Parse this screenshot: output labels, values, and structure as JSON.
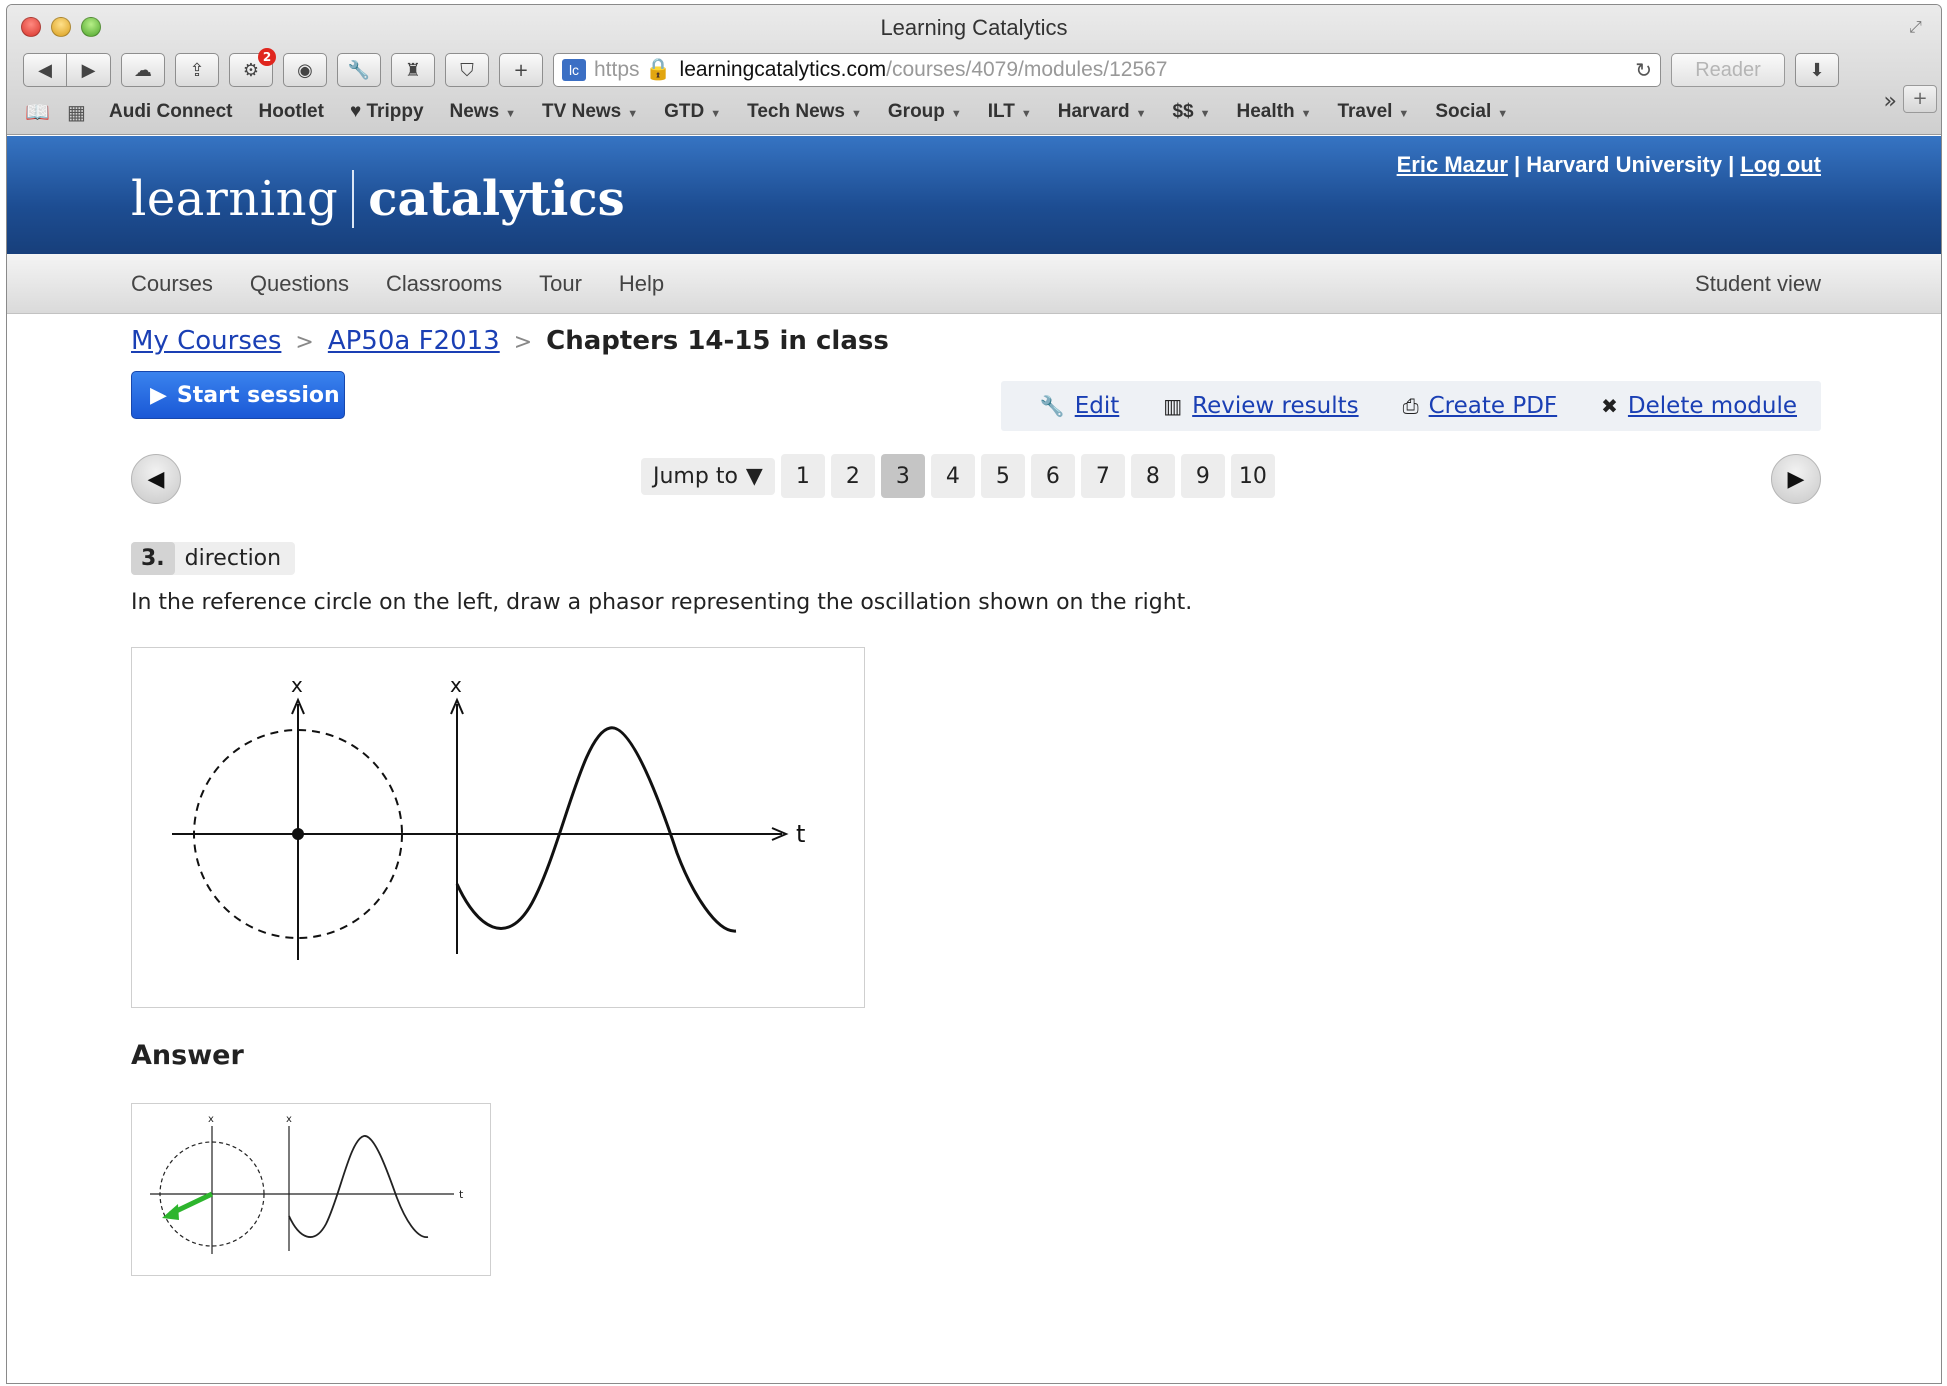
{
  "window": {
    "title": "Learning Catalytics"
  },
  "toolbar": {
    "notification_count": "2",
    "url_scheme": "https",
    "url_host": "learningcatalytics.com",
    "url_path": "/courses/4079/modules/12567",
    "favicon_text": "lc",
    "reader_label": "Reader"
  },
  "bookmarks": [
    {
      "label": "Audi Connect"
    },
    {
      "label": "Hootlet"
    },
    {
      "label": "♥ Trippy"
    },
    {
      "label": "News"
    },
    {
      "label": "TV News"
    },
    {
      "label": "GTD"
    },
    {
      "label": "Tech News"
    },
    {
      "label": "Group"
    },
    {
      "label": "ILT"
    },
    {
      "label": "Harvard"
    },
    {
      "label": "$$"
    },
    {
      "label": "Health"
    },
    {
      "label": "Travel"
    },
    {
      "label": "Social"
    }
  ],
  "header": {
    "logo_left": "learning",
    "logo_right": "catalytics",
    "user_name": "Eric Mazur",
    "institution": "Harvard University",
    "logout": "Log out",
    "separator": "|"
  },
  "nav": {
    "items": [
      "Courses",
      "Questions",
      "Classrooms",
      "Tour",
      "Help"
    ],
    "student_view": "Student view"
  },
  "breadcrumb": {
    "my_courses": "My Courses",
    "course": "AP50a F2013",
    "current": "Chapters 14-15 in class",
    "separator": ">"
  },
  "actions": {
    "start_session": "Start session",
    "edit": "Edit",
    "review_results": "Review results",
    "create_pdf": "Create PDF",
    "delete_module": "Delete module"
  },
  "pager": {
    "jump_to": "Jump to",
    "pages": [
      "1",
      "2",
      "3",
      "4",
      "5",
      "6",
      "7",
      "8",
      "9",
      "10"
    ],
    "current_page": "3"
  },
  "question": {
    "number": "3.",
    "title": "direction",
    "text": "In the reference circle on the left, draw a phasor representing the oscillation shown on the right.",
    "figure_axis_x": "x",
    "figure_axis_t": "t"
  },
  "answer": {
    "heading": "Answer",
    "phasor_color": "#2db52d"
  },
  "colors": {
    "header_blue": "#1d4d92",
    "link_blue": "#1a3fb4",
    "button_blue": "#1a58d6"
  }
}
